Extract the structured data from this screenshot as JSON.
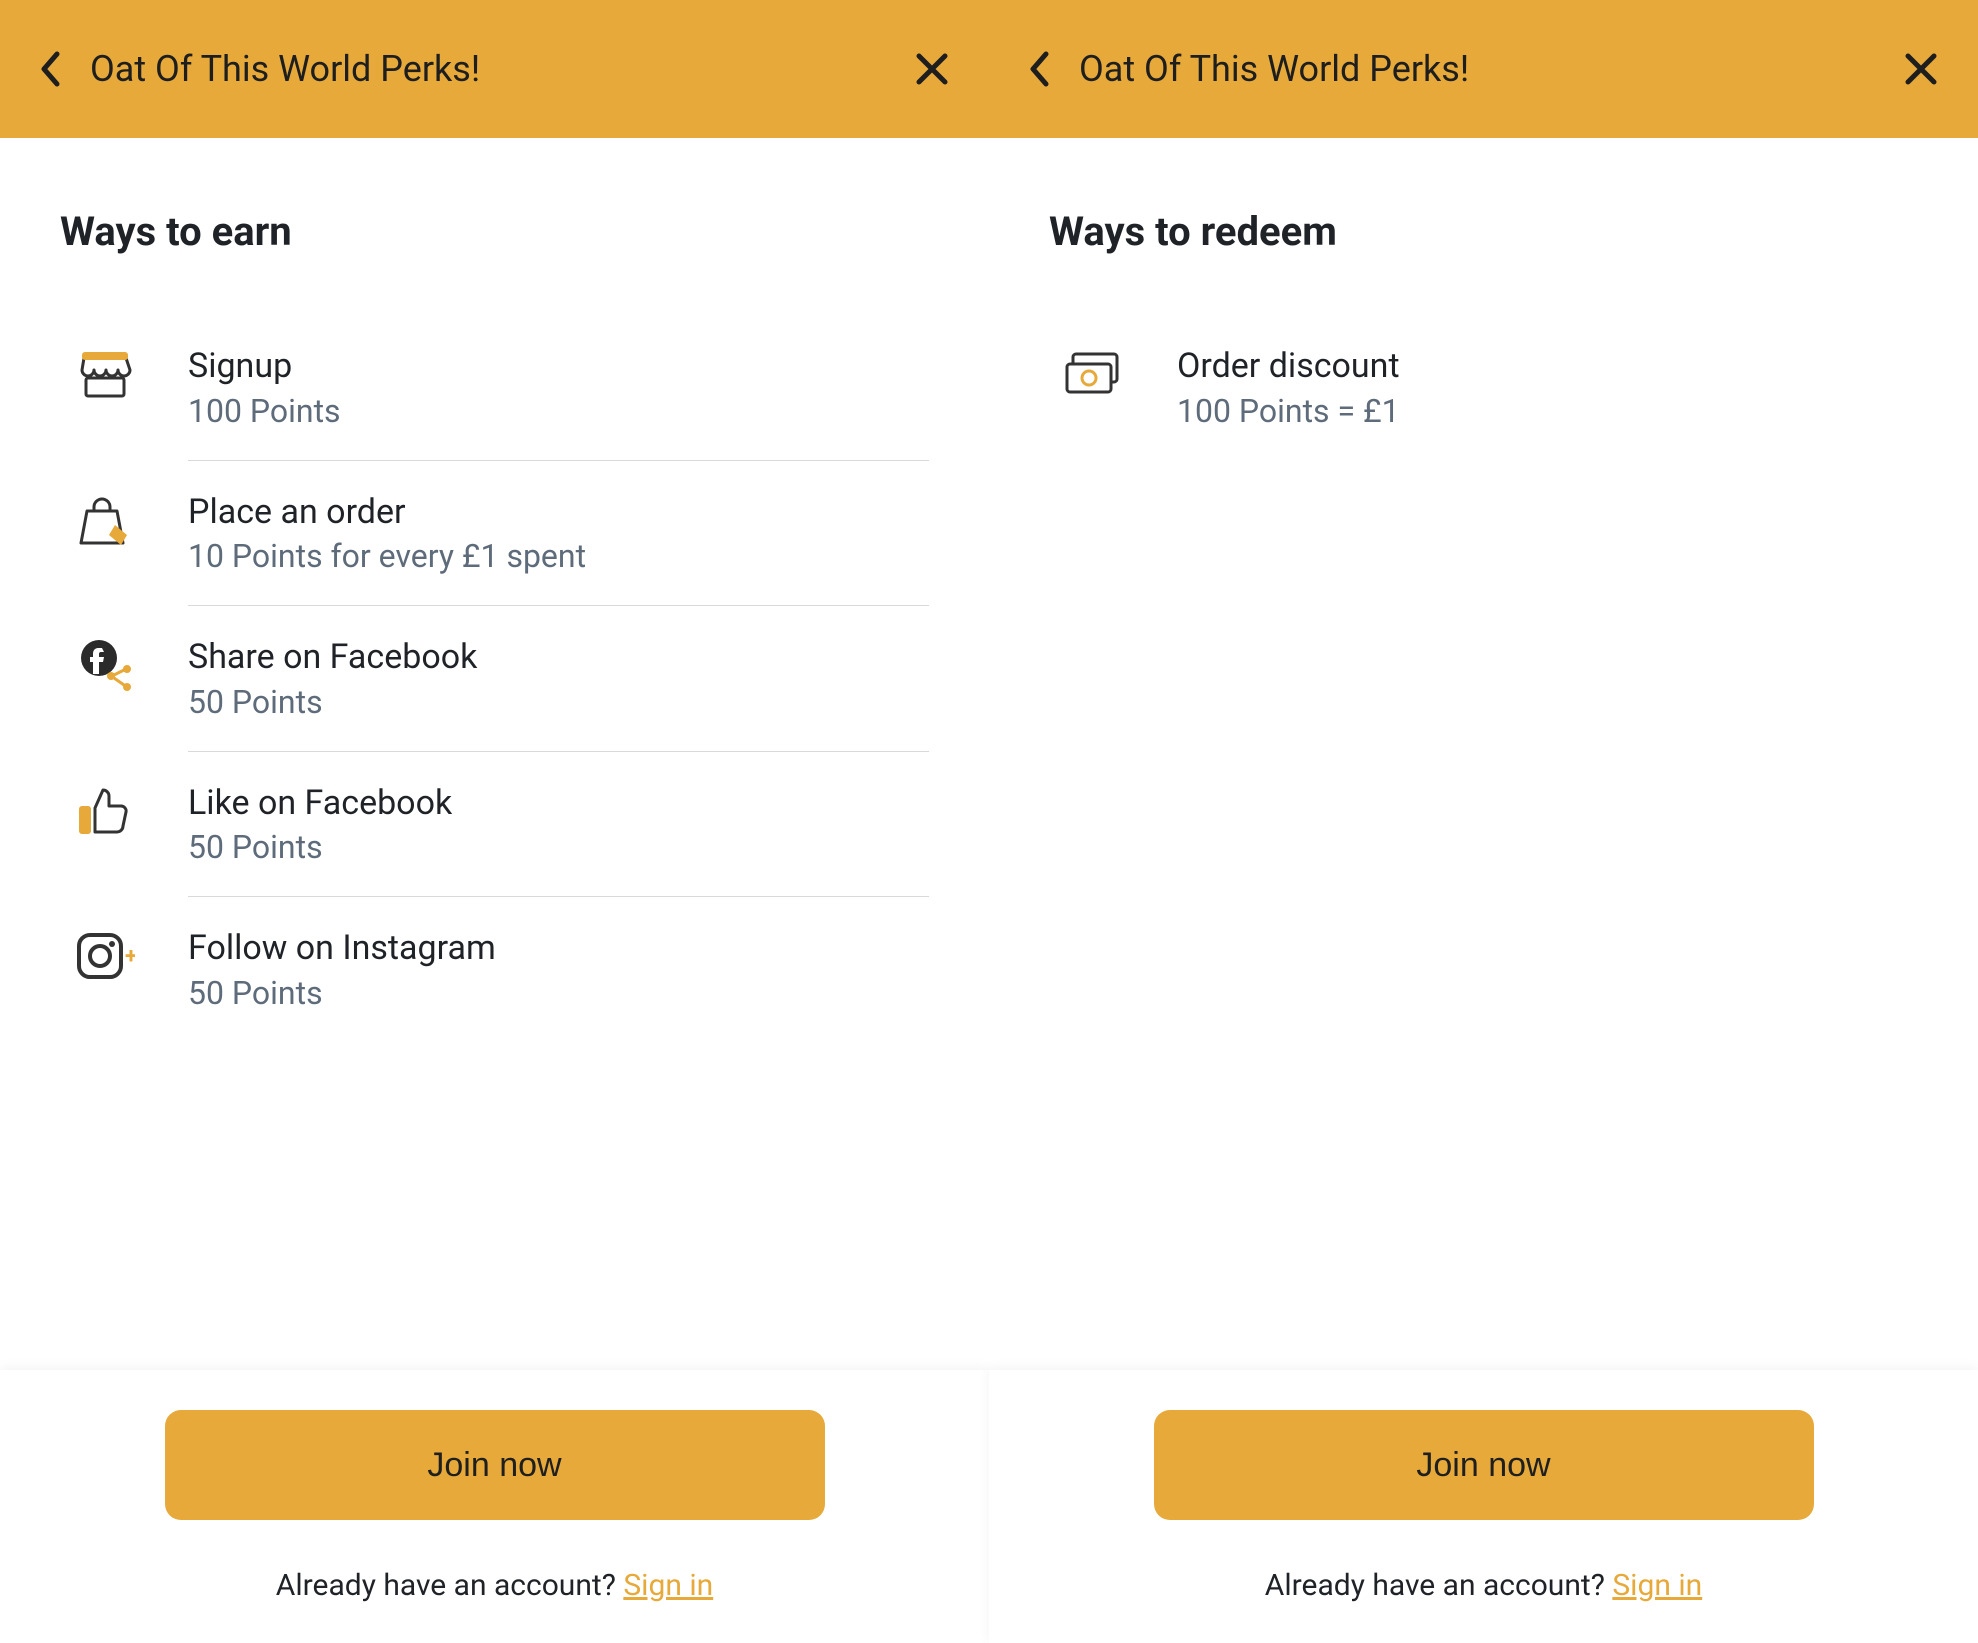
{
  "header_title": "Oat Of This World Perks!",
  "left": {
    "heading": "Ways to earn",
    "items": [
      {
        "icon": "store",
        "label": "Signup",
        "value": "100 Points"
      },
      {
        "icon": "bag",
        "label": "Place an order",
        "value": "10 Points for every £1 spent"
      },
      {
        "icon": "fb-share",
        "label": "Share on Facebook",
        "value": "50 Points"
      },
      {
        "icon": "like",
        "label": "Like on Facebook",
        "value": "50 Points"
      },
      {
        "icon": "instagram",
        "label": "Follow on Instagram",
        "value": "50 Points"
      }
    ]
  },
  "right": {
    "heading": "Ways to redeem",
    "items": [
      {
        "icon": "money",
        "label": "Order discount",
        "value": "100 Points = £1"
      }
    ]
  },
  "cta": {
    "join": "Join now",
    "already_prefix": "Already have an account? ",
    "sign_in": "Sign in"
  }
}
